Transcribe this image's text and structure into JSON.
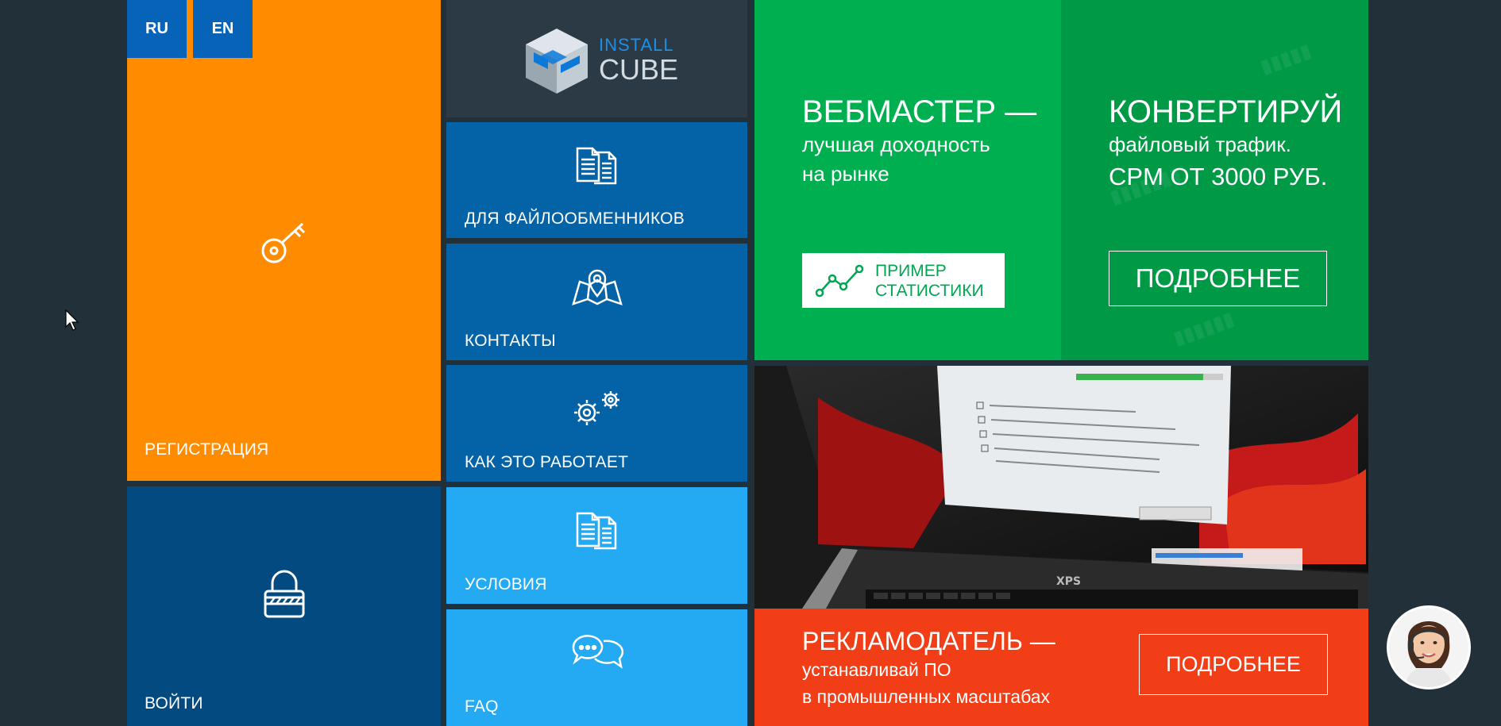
{
  "lang": {
    "ru": "RU",
    "en": "EN"
  },
  "logo": {
    "line1": "INSTALL",
    "line2": "CUBE"
  },
  "tiles": {
    "registration": "РЕГИСТРАЦИЯ",
    "login": "ВОЙТИ",
    "file_hosts": "ДЛЯ ФАЙЛООБМЕННИКОВ",
    "contacts": "КОНТАКТЫ",
    "how_it_works": "КАК ЭТО РАБОТАЕТ",
    "terms": "УСЛОВИЯ",
    "faq": "FAQ"
  },
  "webmaster": {
    "title": "ВЕБМАСТЕР —",
    "line1": "лучшая доходность",
    "line2": "на рынке",
    "stats_btn_line1": "ПРИМЕР",
    "stats_btn_line2": "СТАТИСТИКИ"
  },
  "convert": {
    "title": "КОНВЕРТИРУЙ",
    "line1": "файловый трафик.",
    "line2": "CPM ОТ 3000 РУБ.",
    "button": "ПОДРОБНЕЕ"
  },
  "advertiser": {
    "title": "РЕКЛАМОДАТЕЛЬ —",
    "line1": "устанавливай ПО",
    "line2": "в промышленных масштабах",
    "button": "ПОДРОБНЕЕ"
  },
  "colors": {
    "orange": "#ff8c00",
    "dark_blue": "#024a80",
    "blue": "#0463a6",
    "light_blue": "#24aaf2",
    "green": "#00b050",
    "dark_green": "#009a47",
    "red_orange": "#f23e17",
    "background": "#22303a"
  },
  "icons": [
    "key-icon",
    "padlock-icon",
    "documents-icon",
    "map-pin-icon",
    "gears-icon",
    "chat-icon",
    "chart-line-icon",
    "cube-logo-icon",
    "support-avatar",
    "mouse-cursor-icon"
  ]
}
